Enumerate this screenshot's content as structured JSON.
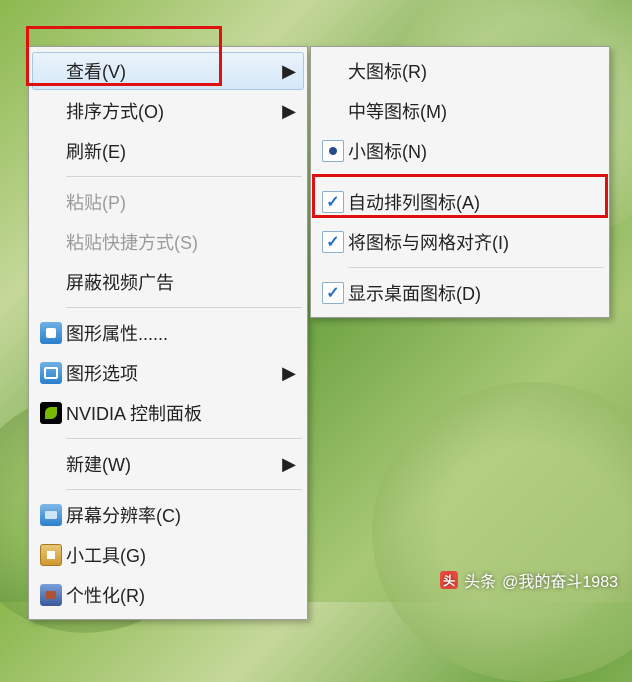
{
  "main_menu": {
    "view": {
      "label": "查看(V)",
      "has_submenu": true,
      "hovered": true
    },
    "sort": {
      "label": "排序方式(O)",
      "has_submenu": true
    },
    "refresh": {
      "label": "刷新(E)"
    },
    "paste": {
      "label": "粘贴(P)",
      "disabled": true
    },
    "paste_shortcut": {
      "label": "粘贴快捷方式(S)",
      "disabled": true
    },
    "block_ads": {
      "label": "屏蔽视频广告"
    },
    "gfx_props": {
      "label": "图形属性......"
    },
    "gfx_options": {
      "label": "图形选项",
      "has_submenu": true
    },
    "nvidia": {
      "label": "NVIDIA 控制面板"
    },
    "new": {
      "label": "新建(W)",
      "has_submenu": true
    },
    "resolution": {
      "label": "屏幕分辨率(C)"
    },
    "gadget": {
      "label": "小工具(G)"
    },
    "personalize": {
      "label": "个性化(R)"
    }
  },
  "sub_menu": {
    "large": {
      "label": "大图标(R)"
    },
    "medium": {
      "label": "中等图标(M)"
    },
    "small": {
      "label": "小图标(N)",
      "selected_radio": true
    },
    "auto": {
      "label": "自动排列图标(A)",
      "checked": true
    },
    "align": {
      "label": "将图标与网格对齐(I)",
      "checked": true
    },
    "showdesk": {
      "label": "显示桌面图标(D)",
      "checked": true
    }
  },
  "watermark": {
    "prefix": "头条",
    "handle": "@我的奋斗1983"
  },
  "glyphs": {
    "arrow_right": "▶",
    "check": "✓"
  }
}
